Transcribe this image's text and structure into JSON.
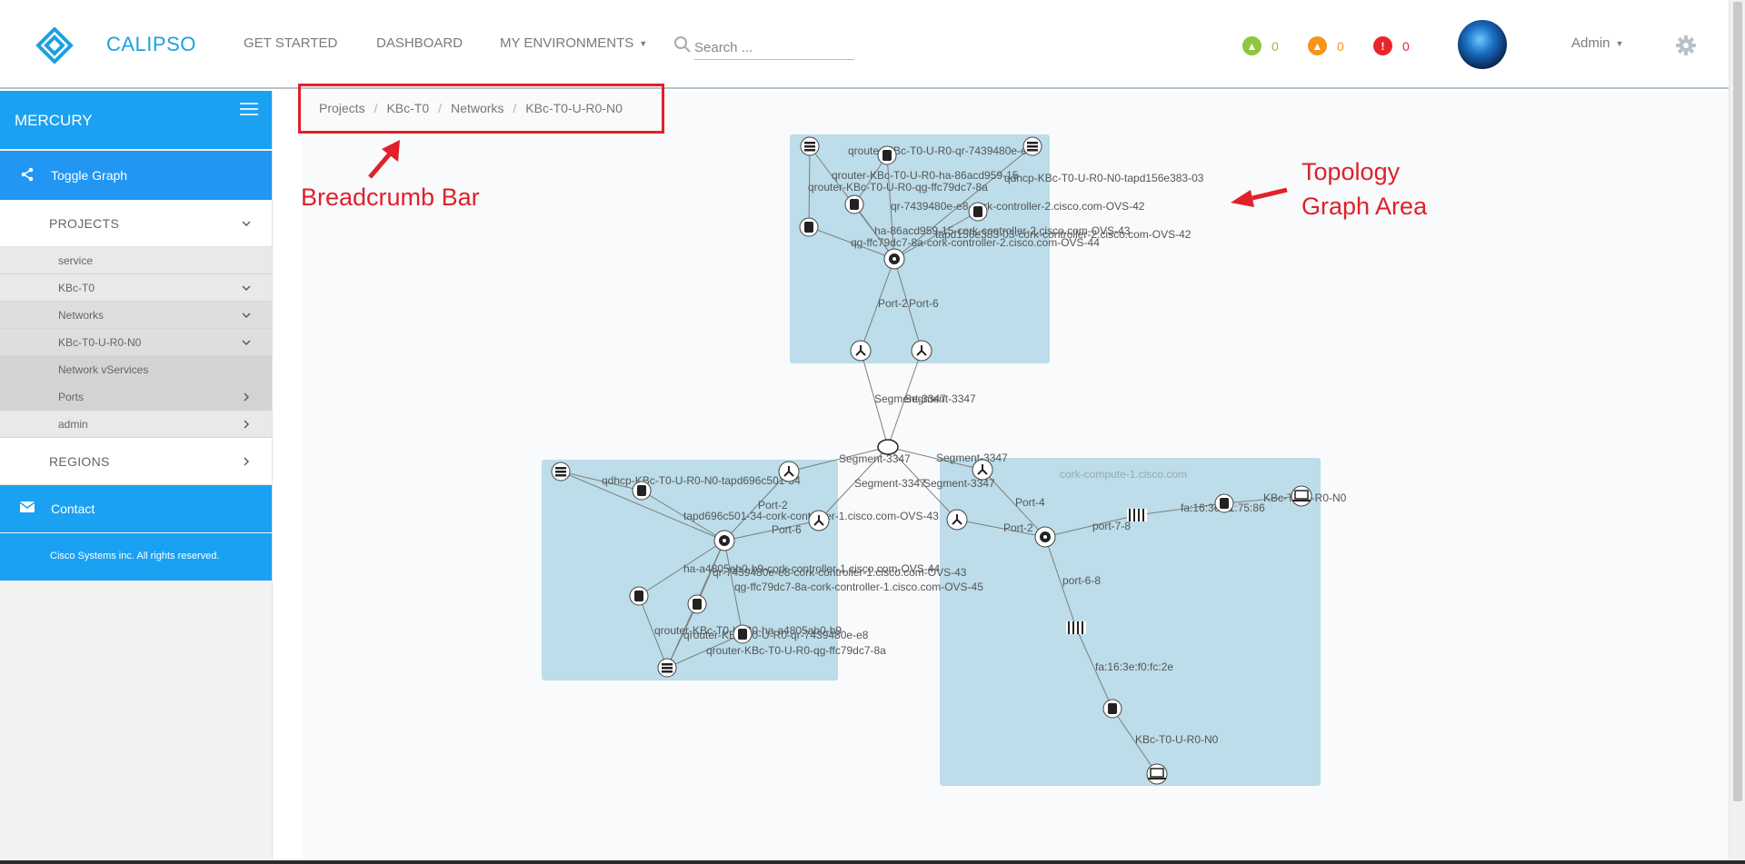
{
  "header": {
    "brand": "CALIPSO",
    "nav": {
      "get_started": "GET STARTED",
      "dashboard": "DASHBOARD",
      "my_environments": "MY ENVIRONMENTS"
    },
    "search_placeholder": "Search ...",
    "stats": {
      "info": "0",
      "warning": "0",
      "error": "0"
    },
    "user": "Admin"
  },
  "sidebar": {
    "environment": "MERCURY",
    "toggle_graph": "Toggle Graph",
    "projects_label": "PROJECTS",
    "items": [
      {
        "label": "service"
      },
      {
        "label": "KBc-T0"
      },
      {
        "label": "Networks"
      },
      {
        "label": "KBc-T0-U-R0-N0"
      },
      {
        "label": "Network vServices"
      },
      {
        "label": "Ports"
      },
      {
        "label": "admin"
      }
    ],
    "regions_label": "REGIONS",
    "contact": "Contact",
    "copyright": "Cisco Systems inc. All rights reserved."
  },
  "breadcrumb": [
    "Projects",
    "KBc-T0",
    "Networks",
    "KBc-T0-U-R0-N0"
  ],
  "annotations": {
    "breadcrumb_bar": "Breadcrumb Bar",
    "topology_line1": "Topology",
    "topology_line2": "Graph Area"
  },
  "graph": {
    "group_label_right": "cork-compute-1.cisco.com",
    "labels": [
      "qrouter-KBc-T0-U-R0-qr-7439480e-e8",
      "qrouter-KBc-T0-U-R0-ha-86acd959-15",
      "qdhcp-KBc-T0-U-R0-N0-tapd156e383-03",
      "qrouter-KBc-T0-U-R0-qg-ffc79dc7-8a",
      "qr-7439480e-e8-cork-controller-2.cisco.com-OVS-42",
      "ha-86acd959-15-cork-controller-2.cisco.com-OVS-43",
      "tapd156e383-03-cork-controller-2.cisco.com-OVS-42",
      "qg-ffc79dc7-8a-cork-controller-2.cisco.com-OVS-44",
      "Port-2",
      "Port-6",
      "Segment-3347",
      "Segment-3347",
      "Segment-3347",
      "Segment-3347",
      "Segment-3347",
      "Segment-3347",
      "qdhcp-KBc-T0-U-R0-N0-tapd696c501-34",
      "Port-2",
      "Port-6",
      "tapd696c501-34-cork-controller-1.cisco.com-OVS-43",
      "ha-a4805ab0-b9-cork-controller-1.cisco.com-OVS-44",
      "qr-7439480e-e8-cork-controller-1.cisco.com-OVS-43",
      "qg-ffc79dc7-8a-cork-controller-1.cisco.com-OVS-45",
      "qrouter-KBc-T0-U-R0-ha-a4805ab0-b9",
      "qrouter-KBc-T0-U-R0-qr-7439480e-e8",
      "qrouter-KBc-T0-U-R0-qg-ffc79dc7-8a",
      "Port-4",
      "Port-2",
      "port-7-8",
      "fa:16:3e:c1:75:86",
      "KBc-T0-U-R0-N0",
      "port-6-8",
      "fa:16:3e:f0:fc:2e",
      "KBc-T0-U-R0-N0"
    ]
  },
  "colors": {
    "brand": "#1ba1e2",
    "sidebar_header": "#1ba1f2",
    "toggle": "#2196f3",
    "group_fill": "#bcdde9",
    "annotation": "#e0202a",
    "info": "#8dc63f",
    "warning": "#f7941d",
    "error": "#e8262a"
  }
}
